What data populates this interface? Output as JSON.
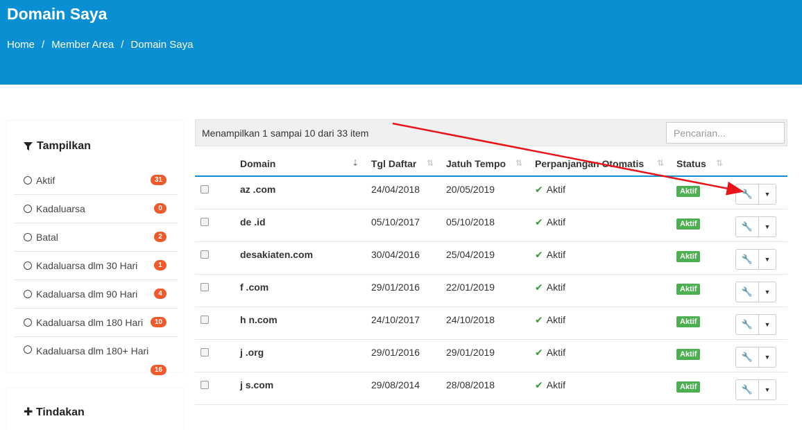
{
  "header": {
    "title": "Domain Saya",
    "breadcrumb": [
      "Home",
      "Member Area",
      "Domain Saya"
    ]
  },
  "sidebar": {
    "title": "Tampilkan",
    "filters": [
      {
        "label": "Aktif",
        "count": "31"
      },
      {
        "label": "Kadaluarsa",
        "count": "0"
      },
      {
        "label": "Batal",
        "count": "2"
      },
      {
        "label": "Kadaluarsa dlm 30 Hari",
        "count": "1"
      },
      {
        "label": "Kadaluarsa dlm 90 Hari",
        "count": "4"
      },
      {
        "label": "Kadaluarsa dlm 180 Hari",
        "count": "10"
      },
      {
        "label": "Kadaluarsa dlm 180+ Hari",
        "count": "16"
      }
    ],
    "actions_title": "Tindakan"
  },
  "table": {
    "info": "Menampilkan 1 sampai 10 dari 33 item",
    "search_placeholder": "Pencarian...",
    "columns": [
      "Domain",
      "Tgl Daftar",
      "Jatuh Tempo",
      "Perpanjangan Otomatis",
      "Status"
    ],
    "rows": [
      {
        "domain": "az  .com",
        "reg": "24/04/2018",
        "due": "20/05/2019",
        "auto": "Aktif",
        "status": "Aktif"
      },
      {
        "domain": "de  .id",
        "reg": "05/10/2017",
        "due": "05/10/2018",
        "auto": "Aktif",
        "status": "Aktif"
      },
      {
        "domain": "desakiaten.com",
        "reg": "30/04/2016",
        "due": "25/04/2019",
        "auto": "Aktif",
        "status": "Aktif"
      },
      {
        "domain": "f  .com",
        "reg": "29/01/2016",
        "due": "22/01/2019",
        "auto": "Aktif",
        "status": "Aktif"
      },
      {
        "domain": "h  n.com",
        "reg": "24/10/2017",
        "due": "24/10/2018",
        "auto": "Aktif",
        "status": "Aktif"
      },
      {
        "domain": "j  .org",
        "reg": "29/01/2016",
        "due": "29/01/2019",
        "auto": "Aktif",
        "status": "Aktif"
      },
      {
        "domain": "j  s.com",
        "reg": "29/08/2014",
        "due": "28/08/2018",
        "auto": "Aktif",
        "status": "Aktif"
      }
    ]
  },
  "colors": {
    "header_bg": "#0a8fd3",
    "badge": "#f0592a",
    "status_green": "#4caf50",
    "annotation_arrow": "#e8141a"
  }
}
